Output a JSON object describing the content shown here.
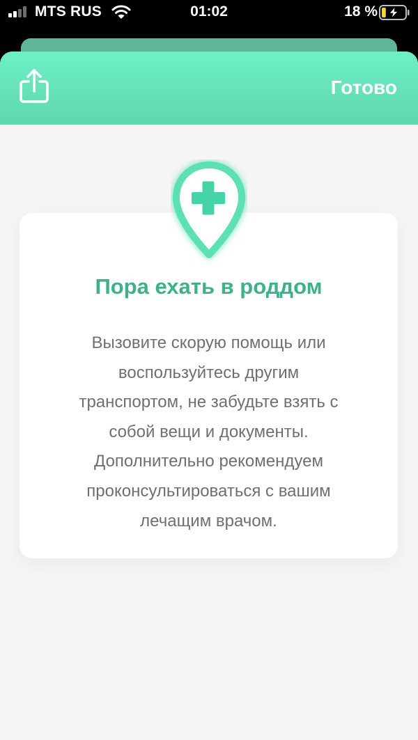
{
  "status_bar": {
    "carrier": "MTS RUS",
    "time": "01:02",
    "battery_percent": "18 %",
    "battery_level": 0.18,
    "charging": true,
    "signal_bars_active": 2,
    "signal_bars_total": 4,
    "icons": [
      "signal-icon",
      "wifi-icon",
      "battery-icon",
      "charging-bolt-icon"
    ]
  },
  "header": {
    "share_icon": "share-icon",
    "done_label": "Готово"
  },
  "card": {
    "icon": "map-pin-medical-cross-icon",
    "title": "Пора ехать в роддом",
    "body_lines": [
      "Вызовите скорую помощь или",
      "воспользуйтесь другим",
      "транспортом, не забудьте взять с",
      "собой вещи и документы.",
      "Дополнительно рекомендуем",
      "проконсультироваться с вашим",
      "лечащим врачом."
    ]
  },
  "colors": {
    "accent_green": "#40b08a",
    "header_gradient_top": "#6ef0c6",
    "header_gradient_bottom": "#5fd6ad",
    "pin_green": "#5de0b3",
    "body_text": "#6f6f6f",
    "sheet_background": "#f5f5f5",
    "battery_yellow": "#f5d63c"
  }
}
